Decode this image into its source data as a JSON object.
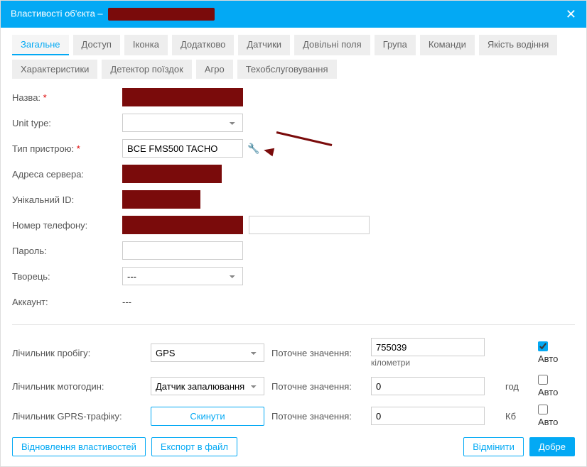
{
  "title_prefix": "Властивості об'єкта –",
  "tabs": {
    "general": "Загальне",
    "access": "Доступ",
    "icon": "Іконка",
    "extra": "Додатково",
    "sensors": "Датчики",
    "custom": "Довільні поля",
    "group": "Група",
    "commands": "Команди",
    "drivequality": "Якість водіння",
    "characteristics": "Характеристики",
    "tripdetector": "Детектор поїздок",
    "agro": "Агро",
    "maint": "Техобслуговування"
  },
  "labels": {
    "name": "Назва:",
    "unit_type": "Unit type:",
    "device_type": "Тип пристрою:",
    "server_addr": "Адреса сервера:",
    "unique_id": "Унікальний ID:",
    "phone": "Номер телефону:",
    "password": "Пароль:",
    "creator": "Творець:",
    "account": "Аккаунт:"
  },
  "values": {
    "device_type": "BCE FMS500 TACHO",
    "creator": "---",
    "account": "---"
  },
  "counters": {
    "mileage_label": "Лічильник пробігу:",
    "mileage_method": "GPS",
    "current_value": "Поточне значення:",
    "mileage_value": "755039",
    "mileage_unit": "кілометри",
    "engine_label": "Лічильник мотогодин:",
    "engine_method": "Датчик запалювання",
    "engine_value": "0",
    "engine_unit": "год",
    "gprs_label": "Лічильник GPRS-трафіку:",
    "reset": "Скинути",
    "gprs_value": "0",
    "gprs_unit": "Кб",
    "auto": "Авто"
  },
  "footer": {
    "restore": "Відновлення властивостей",
    "export": "Експорт в файл",
    "cancel": "Відмінити",
    "ok": "Добре"
  }
}
